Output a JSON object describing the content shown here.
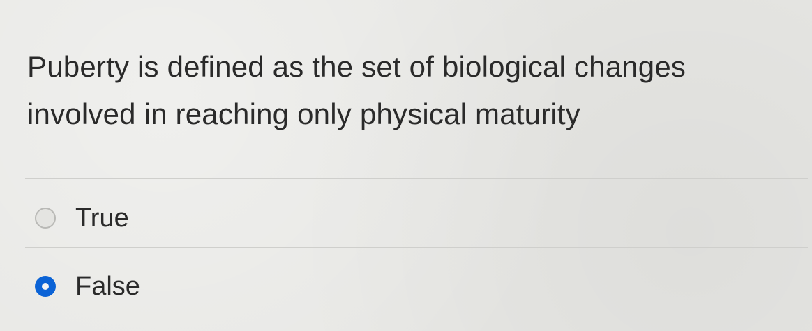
{
  "question": {
    "text": "Puberty is defined as the set of biological changes involved in reaching only physical maturity"
  },
  "answers": [
    {
      "label": "True",
      "selected": false
    },
    {
      "label": "False",
      "selected": true
    }
  ],
  "colors": {
    "selected_radio": "#0b63d6",
    "background": "#e7e7e4"
  }
}
